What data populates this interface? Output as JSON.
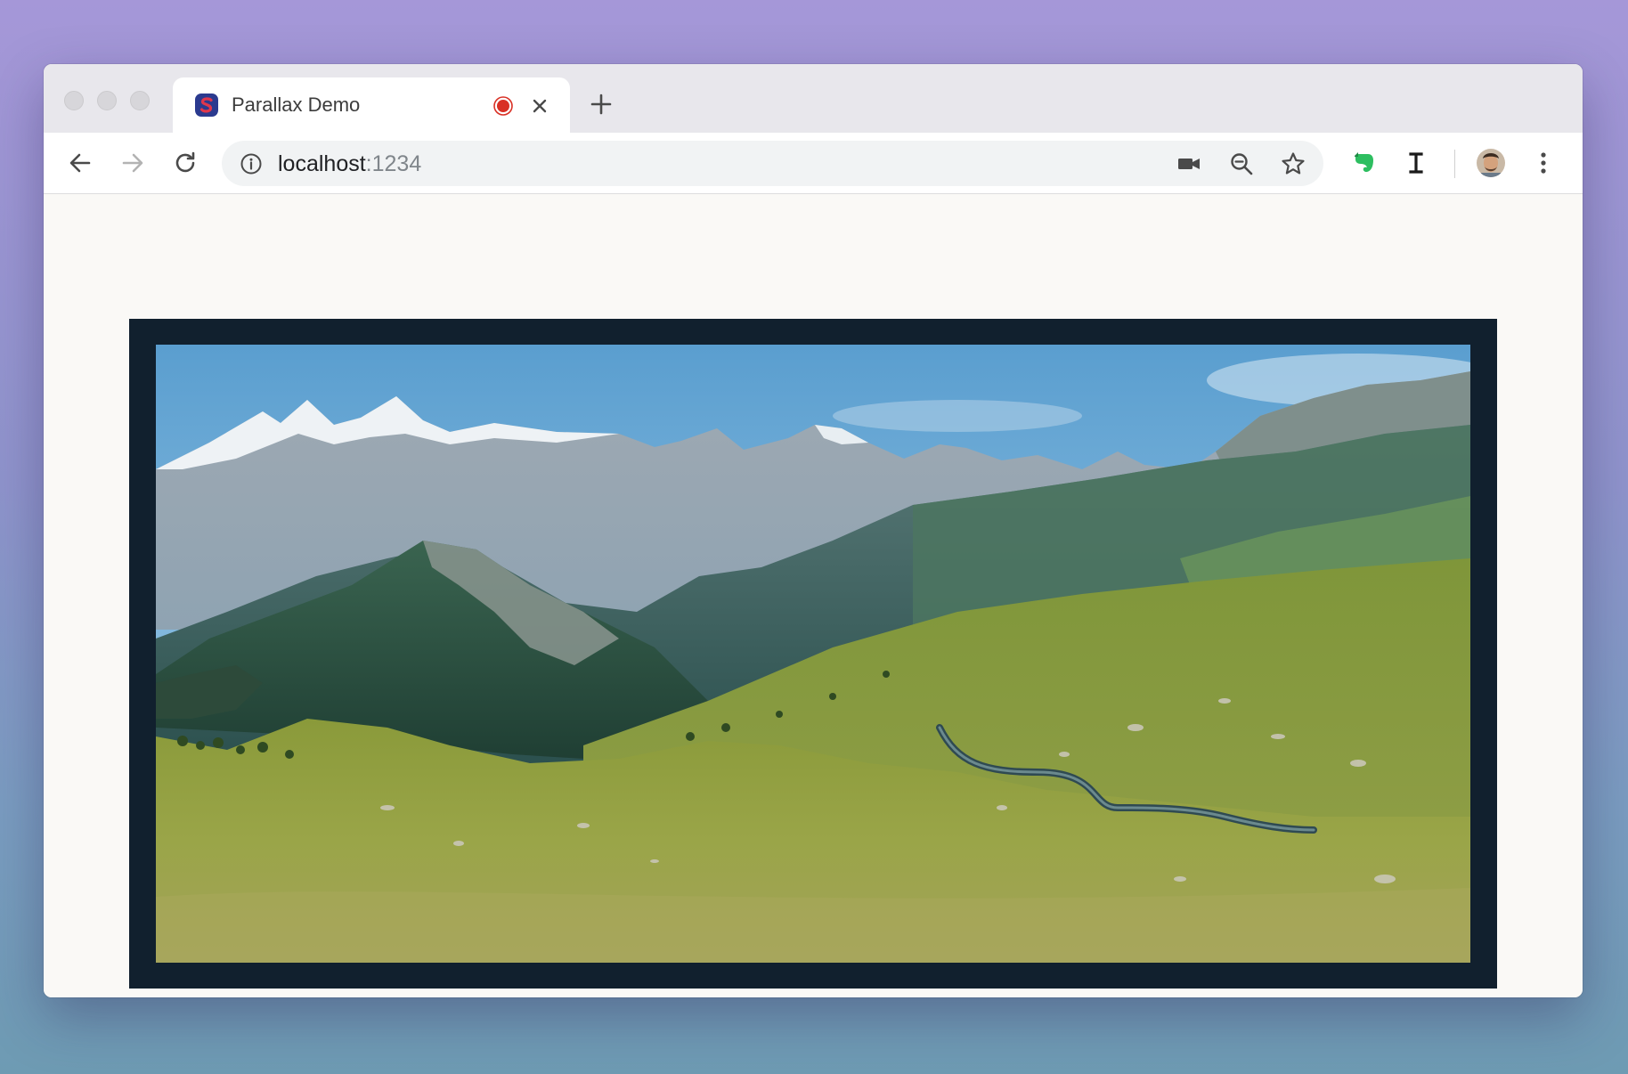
{
  "browser": {
    "tab": {
      "title": "Parallax Demo",
      "favicon": "s-logo-icon",
      "recording_indicator": "record-icon",
      "close_icon": "close-icon"
    },
    "new_tab_icon": "plus-icon",
    "toolbar": {
      "back_icon": "back-arrow-icon",
      "forward_icon": "forward-arrow-icon",
      "reload_icon": "reload-icon",
      "address": {
        "security_icon": "info-icon",
        "host": "localhost",
        "port": ":1234"
      },
      "omnibox_icons": [
        "camera-icon",
        "zoom-out-icon",
        "star-icon"
      ],
      "extensions": [
        "evernote-icon",
        "instapaper-icon"
      ],
      "profile_icon": "avatar",
      "menu_icon": "kebab-menu-icon"
    }
  },
  "page": {
    "image": {
      "subject": "alpine mountain landscape",
      "frame_color": "#11202e"
    }
  },
  "colors": {
    "background_top": "#a597d8",
    "background_bottom": "#6e9bb3",
    "page_background": "#faf9f6",
    "record_red": "#d93025",
    "evernote_green": "#2dbe60",
    "favicon_blue": "#2b3a8f",
    "favicon_red": "#e0374c"
  }
}
